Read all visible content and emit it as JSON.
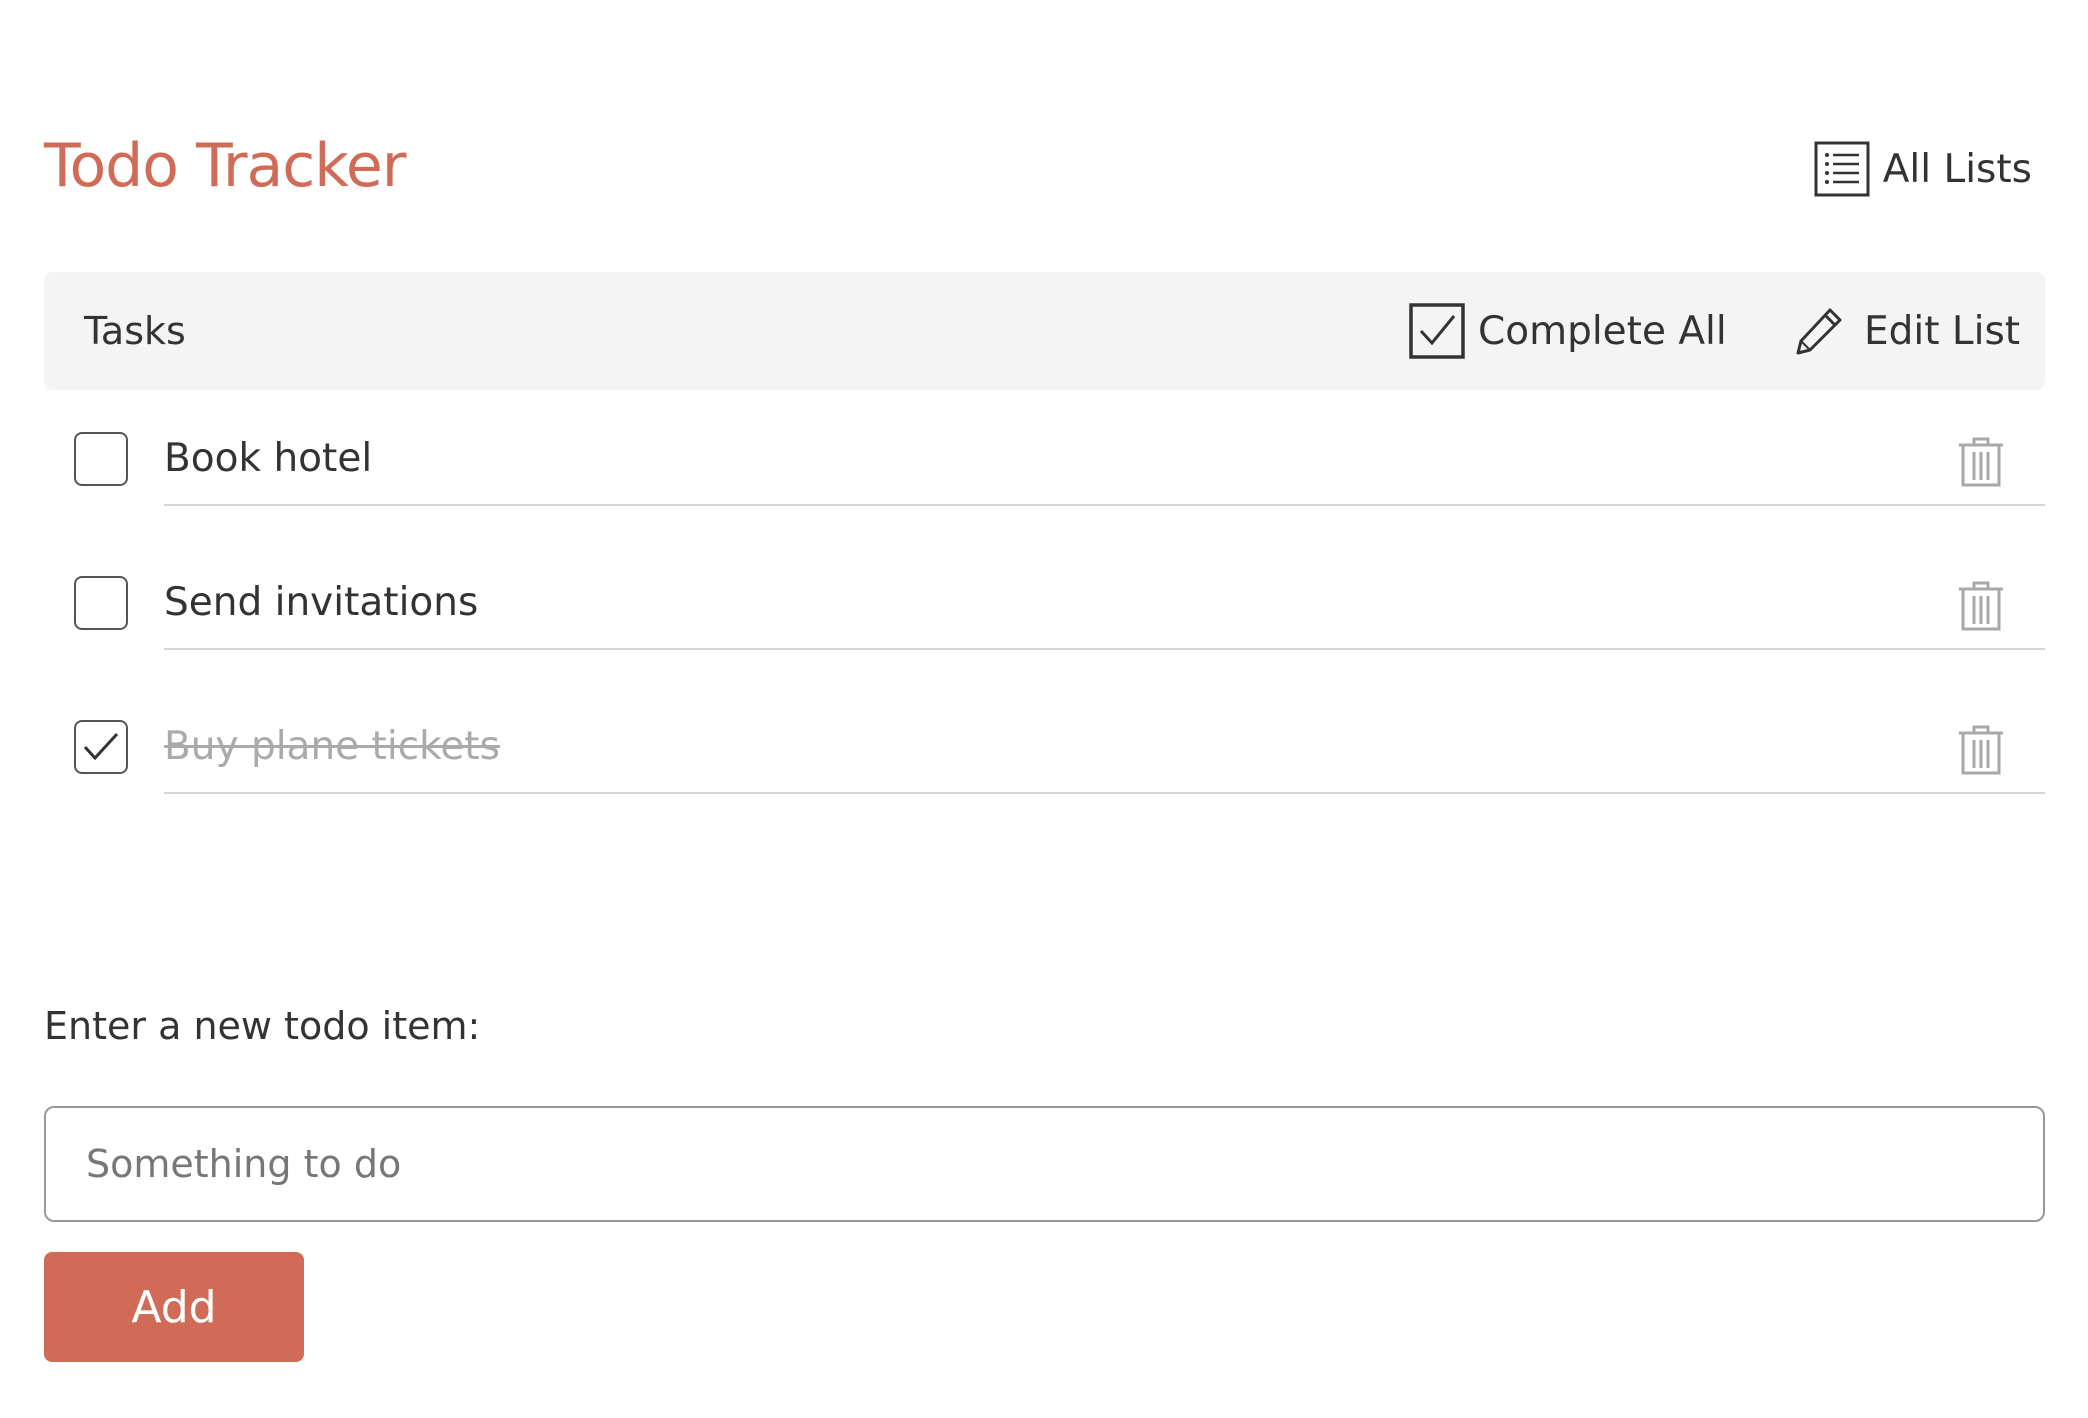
{
  "app": {
    "title": "Todo Tracker",
    "accent_color": "#d06b58"
  },
  "header": {
    "all_lists_label": "All Lists",
    "all_lists_icon": "list-icon"
  },
  "tasks_bar": {
    "label": "Tasks",
    "complete_all_label": "Complete All",
    "complete_all_icon": "checkbox-checked-icon",
    "edit_list_label": "Edit List",
    "edit_list_icon": "pencil-icon"
  },
  "tasks": [
    {
      "text": "Book hotel",
      "completed": false
    },
    {
      "text": "Send invitations",
      "completed": false
    },
    {
      "text": "Buy plane tickets",
      "completed": true
    }
  ],
  "new_item": {
    "label": "Enter a new todo item:",
    "placeholder": "Something to do",
    "value": "",
    "add_label": "Add"
  }
}
